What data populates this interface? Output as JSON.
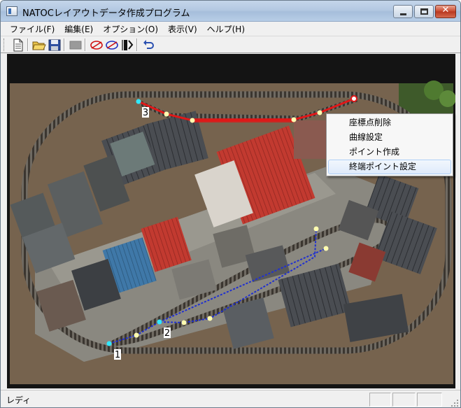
{
  "window": {
    "title": "NATOCレイアウトデータ作成プログラム"
  },
  "menu": {
    "items": [
      {
        "label": "ファイル(F)"
      },
      {
        "label": "編集(E)"
      },
      {
        "label": "オプション(O)"
      },
      {
        "label": "表示(V)"
      },
      {
        "label": "ヘルプ(H)"
      }
    ]
  },
  "toolbar": {
    "buttons": [
      {
        "icon": "new-document-icon"
      },
      {
        "icon": "open-folder-icon"
      },
      {
        "icon": "save-disk-icon"
      },
      {
        "icon": "gray-block-icon"
      },
      {
        "icon": "red-curve-icon"
      },
      {
        "icon": "blue-curve-icon"
      },
      {
        "icon": "end-point-icon"
      },
      {
        "icon": "undo-icon"
      }
    ]
  },
  "canvas": {
    "route_colors": {
      "red": "#e01818",
      "blue": "#2030d0"
    },
    "point_labels": {
      "p1": "1",
      "p2": "2",
      "p3": "3"
    }
  },
  "context_menu": {
    "items": [
      {
        "label": "座標点削除"
      },
      {
        "label": "曲線設定"
      },
      {
        "label": "ポイント作成"
      },
      {
        "label": "終端ポイント設定",
        "highlighted": true
      }
    ]
  },
  "statusbar": {
    "text": "レディ"
  }
}
